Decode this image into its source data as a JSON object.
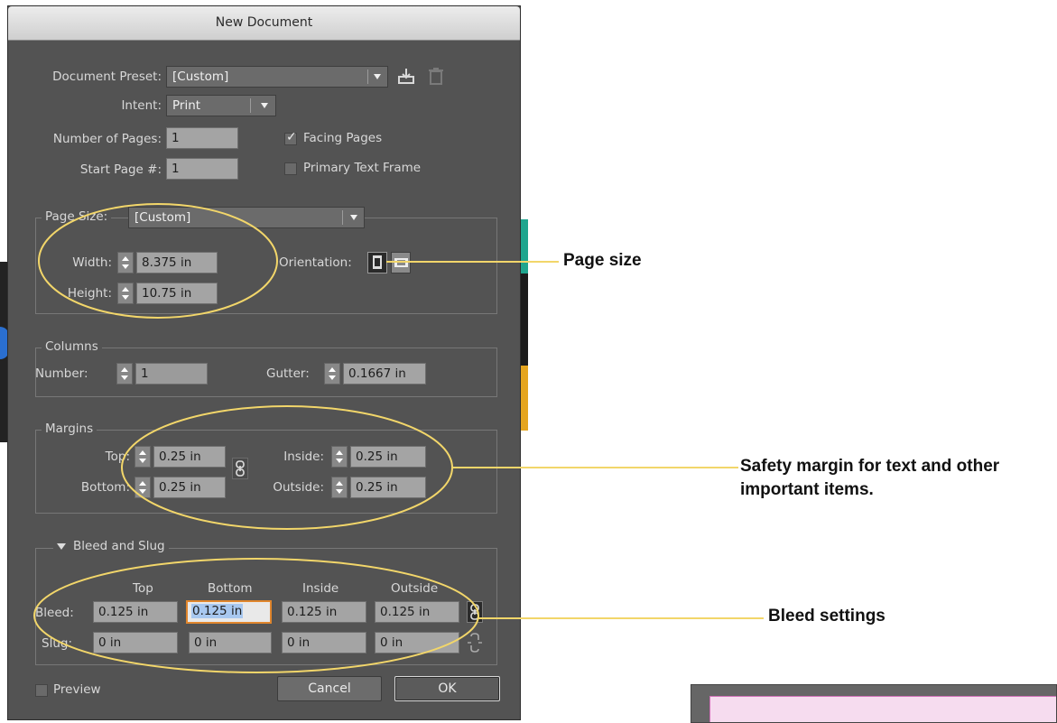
{
  "dialog": {
    "title": "New Document",
    "document_preset": {
      "label": "Document Preset:",
      "value": "[Custom]"
    },
    "intent": {
      "label": "Intent:",
      "value": "Print"
    },
    "number_of_pages": {
      "label": "Number of Pages:",
      "value": "1"
    },
    "start_page": {
      "label": "Start Page #:",
      "value": "1"
    },
    "facing_pages": {
      "label": "Facing Pages",
      "checked": true
    },
    "primary_text_frame": {
      "label": "Primary Text Frame",
      "checked": false
    },
    "page_size": {
      "legend": "Page Size:",
      "value": "[Custom]",
      "width_label": "Width:",
      "width": "8.375 in",
      "height_label": "Height:",
      "height": "10.75 in",
      "orientation_label": "Orientation:"
    },
    "columns": {
      "legend": "Columns",
      "number_label": "Number:",
      "number": "1",
      "gutter_label": "Gutter:",
      "gutter": "0.1667 in"
    },
    "margins": {
      "legend": "Margins",
      "top_label": "Top:",
      "top": "0.25 in",
      "bottom_label": "Bottom:",
      "bottom": "0.25 in",
      "inside_label": "Inside:",
      "inside": "0.25 in",
      "outside_label": "Outside:",
      "outside": "0.25 in"
    },
    "bleed_slug": {
      "legend": "Bleed and Slug",
      "headers": [
        "Top",
        "Bottom",
        "Inside",
        "Outside"
      ],
      "bleed_label": "Bleed:",
      "bleed": [
        "0.125 in",
        "0.125 in",
        "0.125 in",
        "0.125 in"
      ],
      "slug_label": "Slug:",
      "slug": [
        "0 in",
        "0 in",
        "0 in",
        "0 in"
      ]
    },
    "preview": {
      "label": "Preview",
      "checked": false
    },
    "cancel_label": "Cancel",
    "ok_label": "OK"
  },
  "annotations": {
    "page_size": "Page size",
    "margins": "Safety margin for text and other important items.",
    "bleed": "Bleed settings",
    "color": "#f2d66a"
  },
  "colors": {
    "dialog_bg": "#535353",
    "field_bg": "#a4a4a4",
    "active_border": "#e0862d",
    "callout_line": "#f2d66a"
  }
}
